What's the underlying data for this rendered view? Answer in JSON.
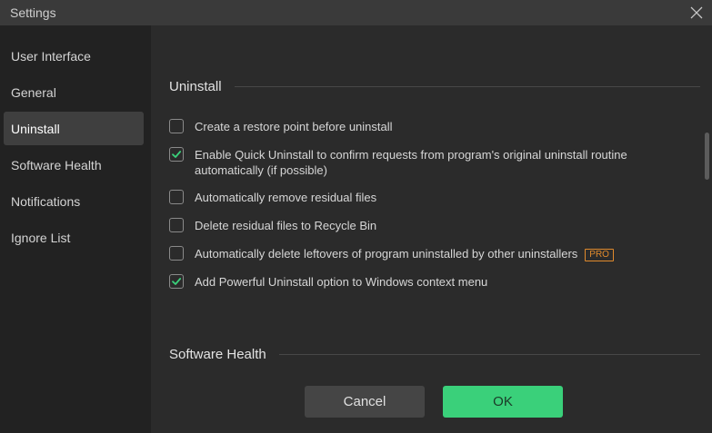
{
  "window": {
    "title": "Settings",
    "close_icon": "close-icon"
  },
  "sidebar": {
    "items": [
      {
        "label": "User Interface",
        "active": false
      },
      {
        "label": "General",
        "active": false
      },
      {
        "label": "Uninstall",
        "active": true
      },
      {
        "label": "Software Health",
        "active": false
      },
      {
        "label": "Notifications",
        "active": false
      },
      {
        "label": "Ignore List",
        "active": false
      }
    ]
  },
  "main": {
    "sections": [
      {
        "title": "Uninstall"
      },
      {
        "title": "Software Health"
      }
    ],
    "options": [
      {
        "label": "Create a restore point before uninstall",
        "checked": false,
        "pro": ""
      },
      {
        "label": "Enable Quick Uninstall to confirm requests from program's original uninstall routine automatically (if possible)",
        "checked": true,
        "pro": ""
      },
      {
        "label": "Automatically remove residual files",
        "checked": false,
        "pro": ""
      },
      {
        "label": "Delete residual files to Recycle Bin",
        "checked": false,
        "pro": ""
      },
      {
        "label": "Automatically delete leftovers of program uninstalled by other uninstallers",
        "checked": false,
        "pro": "PRO"
      },
      {
        "label": "Add Powerful Uninstall option to Windows context menu",
        "checked": true,
        "pro": ""
      }
    ]
  },
  "buttons": {
    "cancel_label": "Cancel",
    "ok_label": "OK"
  },
  "colors": {
    "accent": "#3ad07a",
    "pro_badge": "#e08a2c",
    "checkmark": "#3ad07a"
  }
}
